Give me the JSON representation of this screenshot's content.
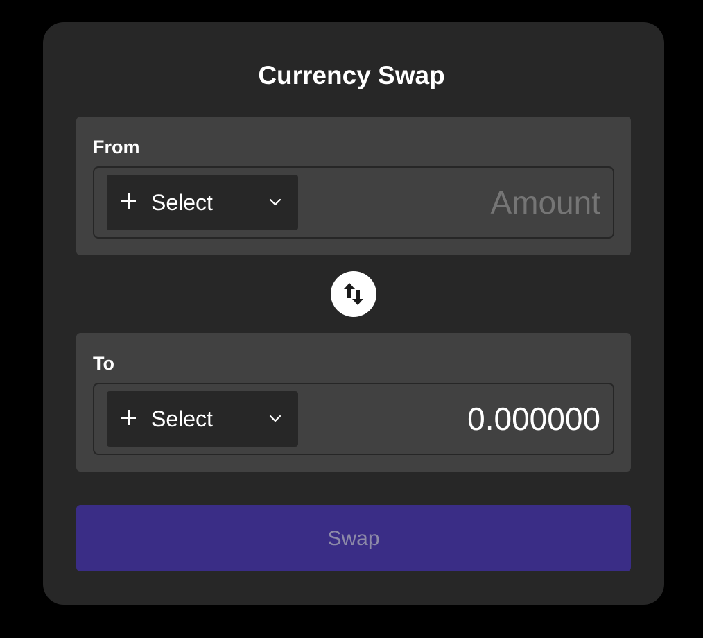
{
  "title": "Currency Swap",
  "from": {
    "label": "From",
    "currency_select": {
      "label": "Select",
      "icon": "plus-icon"
    },
    "amount": {
      "value": "",
      "placeholder": "Amount"
    }
  },
  "to": {
    "label": "To",
    "currency_select": {
      "label": "Select",
      "icon": "plus-icon"
    },
    "amount": {
      "value": "0.000000"
    }
  },
  "swap_button": {
    "label": "Swap",
    "disabled": true
  },
  "colors": {
    "background": "#000000",
    "card": "#272727",
    "panel": "#414141",
    "select": "#272727",
    "accent": "#3a2d86",
    "accent_text": "#8d8aa8",
    "placeholder": "#8f8f8f"
  }
}
